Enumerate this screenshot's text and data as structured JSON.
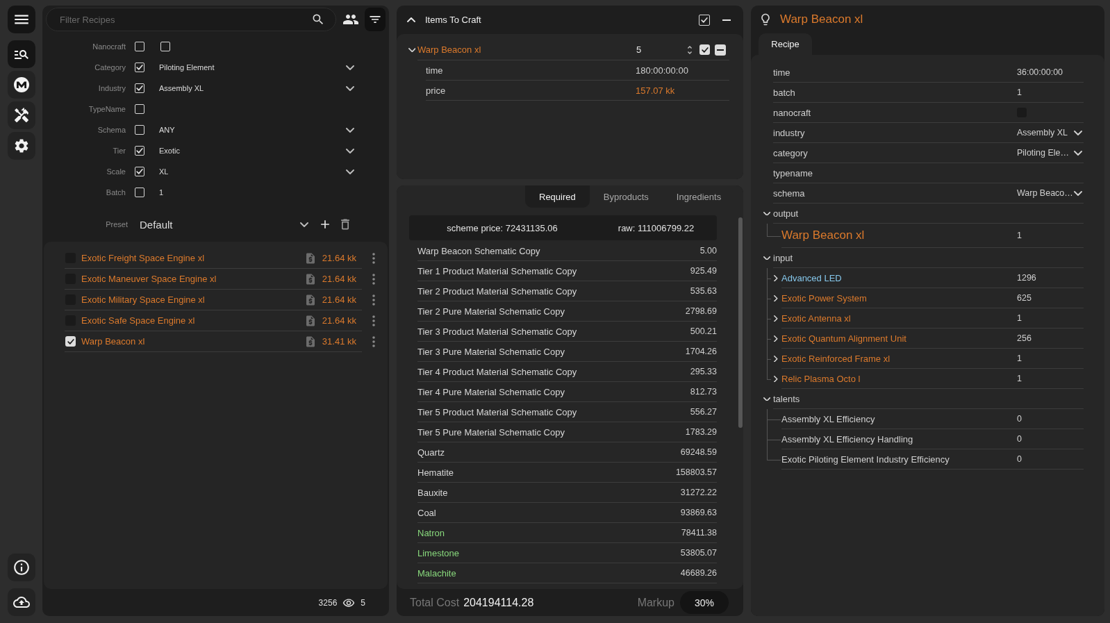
{
  "sidebar": {
    "items": [
      {
        "selected": true
      },
      {
        "selected": false
      },
      {
        "selected": false
      },
      {
        "selected": false
      }
    ]
  },
  "filter_panel": {
    "search": {
      "placeholder": "Filter Recipes"
    },
    "filter_toggle": {
      "selected": true
    },
    "filters": [
      {
        "label": "Nanocraft",
        "kind": "toggle",
        "checked": false,
        "value_checked": false
      },
      {
        "label": "Category",
        "kind": "select",
        "checked": true,
        "value": "Piloting Element"
      },
      {
        "label": "Industry",
        "kind": "select",
        "checked": true,
        "value": "Assembly XL"
      },
      {
        "label": "TypeName",
        "kind": "text",
        "checked": false
      },
      {
        "label": "Schema",
        "kind": "select",
        "checked": false,
        "value": "ANY"
      },
      {
        "label": "Tier",
        "kind": "select",
        "checked": true,
        "value": "Exotic"
      },
      {
        "label": "Scale",
        "kind": "select",
        "checked": true,
        "value": "XL"
      },
      {
        "label": "Batch",
        "kind": "text",
        "checked": false,
        "value": "1"
      }
    ],
    "preset": {
      "label": "Preset",
      "value": "Default"
    },
    "recipes": [
      {
        "name": "Exotic Freight Space Engine xl",
        "price": "21.64 kk",
        "checked": false
      },
      {
        "name": "Exotic Maneuver Space Engine xl",
        "price": "21.64 kk",
        "checked": false
      },
      {
        "name": "Exotic Military Space Engine xl",
        "price": "21.64 kk",
        "checked": false
      },
      {
        "name": "Exotic Safe Space Engine xl",
        "price": "21.64 kk",
        "checked": false
      },
      {
        "name": "Warp Beacon xl",
        "price": "31.41 kk",
        "checked": true
      }
    ],
    "footer": {
      "count": "3256",
      "visible": "5"
    }
  },
  "craft_panel": {
    "title": "Items To Craft",
    "expanded": true,
    "all_checked": true,
    "items": [
      {
        "name": "Warp Beacon xl",
        "quantity": "5",
        "expanded": true,
        "checked": true,
        "fields": [
          {
            "label": "time",
            "value": "180:00:00:00",
            "kind": "plain"
          },
          {
            "label": "price",
            "value": "157.07 kk",
            "kind": "price"
          }
        ]
      }
    ],
    "tabs": [
      {
        "label": "Required",
        "selected": true
      },
      {
        "label": "Byproducts",
        "selected": false
      },
      {
        "label": "Ingredients",
        "selected": false
      }
    ],
    "summary": {
      "scheme_price": "scheme price: 72431135.06",
      "raw": "raw: 111006799.22"
    },
    "materials": [
      {
        "name": "Warp Beacon Schematic Copy",
        "amount": "5.00",
        "color": "#d6d6d6"
      },
      {
        "name": "Tier 1 Product Material Schematic Copy",
        "amount": "925.49",
        "color": "#d6d6d6"
      },
      {
        "name": "Tier 2 Product Material Schematic Copy",
        "amount": "535.63",
        "color": "#d6d6d6"
      },
      {
        "name": "Tier 2 Pure Material Schematic Copy",
        "amount": "2798.69",
        "color": "#d6d6d6"
      },
      {
        "name": "Tier 3 Product Material Schematic Copy",
        "amount": "500.21",
        "color": "#d6d6d6"
      },
      {
        "name": "Tier 3 Pure Material Schematic Copy",
        "amount": "1704.26",
        "color": "#d6d6d6"
      },
      {
        "name": "Tier 4 Product Material Schematic Copy",
        "amount": "295.33",
        "color": "#d6d6d6"
      },
      {
        "name": "Tier 4 Pure Material Schematic Copy",
        "amount": "812.73",
        "color": "#d6d6d6"
      },
      {
        "name": "Tier 5 Product Material Schematic Copy",
        "amount": "556.27",
        "color": "#d6d6d6"
      },
      {
        "name": "Tier 5 Pure Material Schematic Copy",
        "amount": "1783.29",
        "color": "#d6d6d6"
      },
      {
        "name": "Quartz",
        "amount": "69248.59",
        "color": "#d6d6d6"
      },
      {
        "name": "Hematite",
        "amount": "158803.57",
        "color": "#d6d6d6"
      },
      {
        "name": "Bauxite",
        "amount": "31272.22",
        "color": "#d6d6d6"
      },
      {
        "name": "Coal",
        "amount": "93869.63",
        "color": "#d6d6d6"
      },
      {
        "name": "Natron",
        "amount": "78411.38",
        "color": "#88d87c"
      },
      {
        "name": "Limestone",
        "amount": "53805.07",
        "color": "#88d87c"
      },
      {
        "name": "Malachite",
        "amount": "46689.26",
        "color": "#88d87c"
      }
    ],
    "total": {
      "label": "Total Cost",
      "value": "204194114.28"
    },
    "markup": {
      "label": "Markup",
      "value": "30%"
    }
  },
  "recipe_panel": {
    "title": "Warp Beacon xl",
    "tabs": [
      {
        "label": "Recipe",
        "selected": true
      }
    ],
    "properties": [
      {
        "label": "time",
        "kind": "text",
        "value": "36:00:00:00"
      },
      {
        "label": "batch",
        "kind": "text",
        "value": "1"
      },
      {
        "label": "nanocraft",
        "kind": "checkbox",
        "checked": false
      },
      {
        "label": "industry",
        "kind": "select",
        "value": "Assembly XL"
      },
      {
        "label": "category",
        "kind": "select",
        "value": "Piloting Ele…"
      },
      {
        "label": "typename",
        "kind": "text"
      },
      {
        "label": "schema",
        "kind": "select",
        "value": "Warp Beaco…"
      }
    ],
    "sections": [
      {
        "label": "output",
        "kind": "output",
        "expanded": true,
        "items": [
          {
            "name": "Warp Beacon xl",
            "amount": "1",
            "color": "#dc7a2c"
          }
        ]
      },
      {
        "label": "input",
        "kind": "input",
        "expanded": true,
        "items": [
          {
            "name": "Advanced LED",
            "amount": "1296",
            "color": "#86c8ec",
            "expanded": false
          },
          {
            "name": "Exotic Power System",
            "amount": "625",
            "color": "#dc7a2c",
            "expanded": false
          },
          {
            "name": "Exotic Antenna xl",
            "amount": "1",
            "color": "#dc7a2c",
            "expanded": false
          },
          {
            "name": "Exotic Quantum Alignment Unit",
            "amount": "256",
            "color": "#dc7a2c",
            "expanded": false
          },
          {
            "name": "Exotic Reinforced Frame xl",
            "amount": "1",
            "color": "#dc7a2c",
            "expanded": false
          },
          {
            "name": "Relic Plasma Octo l",
            "amount": "1",
            "color": "#dc7a2c",
            "expanded": false
          }
        ]
      },
      {
        "label": "talents",
        "kind": "talent",
        "expanded": true,
        "items": [
          {
            "name": "Assembly XL Efficiency",
            "amount": "0",
            "color": "#d0d0d0"
          },
          {
            "name": "Assembly XL Efficiency Handling",
            "amount": "0",
            "color": "#d0d0d0"
          },
          {
            "name": "Exotic Piloting Element Industry Efficiency",
            "amount": "0",
            "color": "#d0d0d0"
          }
        ]
      }
    ]
  }
}
